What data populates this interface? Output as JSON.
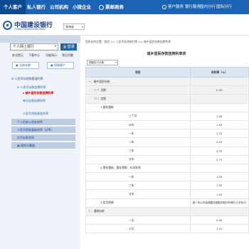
{
  "topnav": {
    "items": [
      "个人客户",
      "私人银行",
      "公司机构",
      "小微企业",
      "票邮商务"
    ],
    "right": [
      "客户服务",
      "银行服务",
      "国内分行",
      "国际分行"
    ]
  },
  "header": {
    "logo_cn": "中国建设银行",
    "logo_en": "China Construction Bank",
    "city": "青海省"
  },
  "sidebar": {
    "login_select": "个人网上银行",
    "login_button": "登录",
    "quick_links": [
      "安全提示",
      "下载中心",
      "功能演示",
      "常见问题"
    ],
    "register_button": "注册关联",
    "certificate_button": "网银客户",
    "menu": [
      {
        "label": "人民币存贷款基准利率",
        "kind": "head"
      },
      {
        "label": "人民币存款挂牌利率",
        "kind": "item"
      },
      {
        "label": "城乡居民存款挂牌利率",
        "kind": "sel"
      },
      {
        "label": "单位存款挂牌利率",
        "kind": "item"
      },
      {
        "label": "人民币贷款基准利率",
        "kind": "item"
      },
      {
        "label": "个人住房公积金利率",
        "kind": "bar"
      },
      {
        "label": "人民币贷款基础利率（LPR）",
        "kind": "bar"
      },
      {
        "label": "外币存款利率",
        "kind": "bar"
      },
      {
        "label": "理财计算器",
        "kind": "bar"
      }
    ]
  },
  "main": {
    "breadcrumb": "您所在的位置：首页 >> 人民币存贷款利率 >> 城乡居民存款挂牌利率",
    "title": "城乡居民存款挂牌利率表",
    "date_select": "调整执行日期",
    "table": {
      "headers": [
        "项目",
        "年利率（%）"
      ],
      "rows": [
        {
          "item": "一、城乡居民存款",
          "rate": "",
          "indent": 0,
          "shade": true
        },
        {
          "item": "（一）活期",
          "rate": "0.30",
          "indent": 1,
          "shade": true
        },
        {
          "item": "（二）定期",
          "rate": "",
          "indent": 1,
          "shade": true
        },
        {
          "item": "1.整存整取",
          "rate": "",
          "indent": 2,
          "shade": false
        },
        {
          "item": "三个月",
          "rate": "1.35",
          "indent": 3,
          "shade": false
        },
        {
          "item": "半年",
          "rate": "1.55",
          "indent": 3,
          "shade": false
        },
        {
          "item": "一年",
          "rate": "1.75",
          "indent": 3,
          "shade": false
        },
        {
          "item": "二年",
          "rate": "2.25",
          "indent": 3,
          "shade": false
        },
        {
          "item": "三年",
          "rate": "2.75",
          "indent": 3,
          "shade": false
        },
        {
          "item": "五年",
          "rate": "2.75",
          "indent": 3,
          "shade": false
        },
        {
          "item": "2.零存整取、整存零取、存本取息",
          "rate": "",
          "indent": 2,
          "shade": false
        },
        {
          "item": "一年",
          "rate": "1.35",
          "indent": 3,
          "shade": false
        },
        {
          "item": "三年",
          "rate": "1.55",
          "indent": 3,
          "shade": false
        },
        {
          "item": "五年",
          "rate": "1.55",
          "indent": 3,
          "shade": false
        },
        {
          "item": "3.定活两便",
          "rate": "按一年以内定期整存整取同档次利率打六折执行",
          "indent": 2,
          "shade": false
        },
        {
          "item": "二、通知存款",
          "rate": "",
          "indent": 0,
          "shade": true
        },
        {
          "item": "一天",
          "rate": "0.55",
          "indent": 3,
          "shade": false
        },
        {
          "item": "七天",
          "rate": "1.10",
          "indent": 3,
          "shade": false
        }
      ]
    }
  }
}
